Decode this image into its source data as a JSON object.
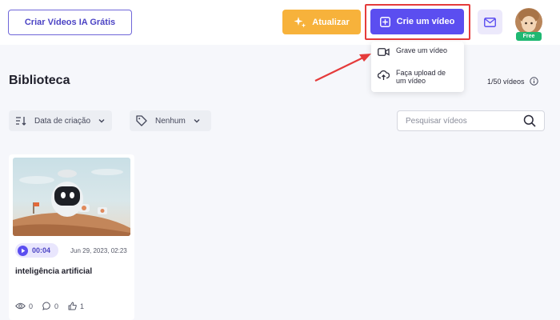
{
  "header": {
    "create_ai_label": "Criar Vídeos IA Grátis",
    "upgrade_label": "Atualizar",
    "create_video_label": "Crie um vídeo",
    "free_badge": "Free"
  },
  "dropdown": {
    "items": [
      {
        "label": "Grave um vídeo",
        "icon": "video-camera-icon"
      },
      {
        "label": "Faça upload de um vídeo",
        "icon": "upload-cloud-icon"
      }
    ]
  },
  "library": {
    "title": "Biblioteca",
    "count": "1/50 vídeos"
  },
  "filters": {
    "sort_label": "Data de criação",
    "tag_label": "Nenhum",
    "search_placeholder": "Pesquisar vídeos"
  },
  "videos": [
    {
      "duration": "00:04",
      "date": "Jun 29, 2023, 02:23",
      "title": "inteligência artificial",
      "views": "0",
      "comments": "0",
      "likes": "1"
    }
  ],
  "colors": {
    "primary": "#5b4ef0",
    "upgrade": "#f7b23b",
    "highlight": "#e53b3b",
    "free": "#1fb872"
  }
}
